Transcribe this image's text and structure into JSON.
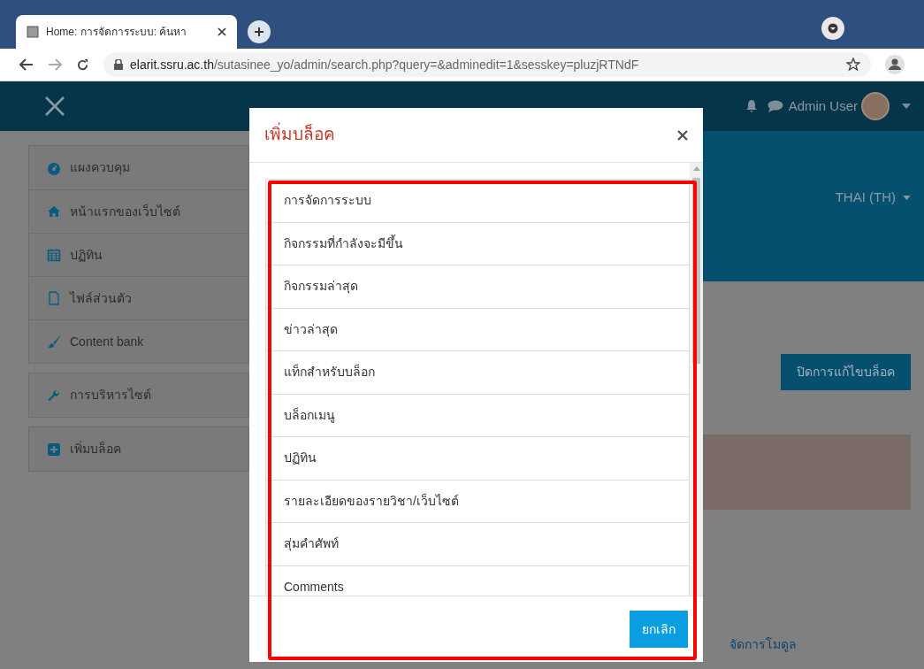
{
  "browser": {
    "tab_title": "Home: การจัดการระบบ: ค้นหา",
    "url_host": "elarit.ssru.ac.th",
    "url_path": "/sutasinee_yo/admin/search.php?query=&adminedit=1&sesskey=pluzjRTNdF"
  },
  "navbar": {
    "user_name": "Admin User"
  },
  "sidebar": {
    "groups": [
      [
        {
          "label": "แผงควบคุม",
          "kind": "dashboard"
        },
        {
          "label": "หน้าแรกของเว็บไซต์",
          "kind": "home"
        },
        {
          "label": "ปฏิทิน",
          "kind": "calendar"
        },
        {
          "label": "ไฟล์ส่วนตัว",
          "kind": "file"
        },
        {
          "label": "Content bank",
          "kind": "brush"
        }
      ],
      [
        {
          "label": "การบริหารไซต์",
          "kind": "wrench"
        }
      ],
      [
        {
          "label": "เพิ่มบล็อค",
          "kind": "plus"
        }
      ]
    ]
  },
  "header": {
    "language": "THAI (TH)"
  },
  "page": {
    "edit_button": "ปิดการแก้ไขบล็อค",
    "manage_link": "จัดการโมดูล"
  },
  "modal": {
    "title": "เพิ่มบล็อค",
    "blocks": [
      "การจัดการระบบ",
      "กิจกรรมที่กำลังจะมีขึ้น",
      "กิจกรรมล่าสุด",
      "ข่าวล่าสุด",
      "แท็กสำหรับบล็อก",
      "บล็อกเมนู",
      "ปฏิทิน",
      "รายละเอียดของรายวิชา/เว็บไซต์",
      "สุ่มคำศัพท์",
      "Comments"
    ],
    "cancel": "ยกเลิก"
  }
}
